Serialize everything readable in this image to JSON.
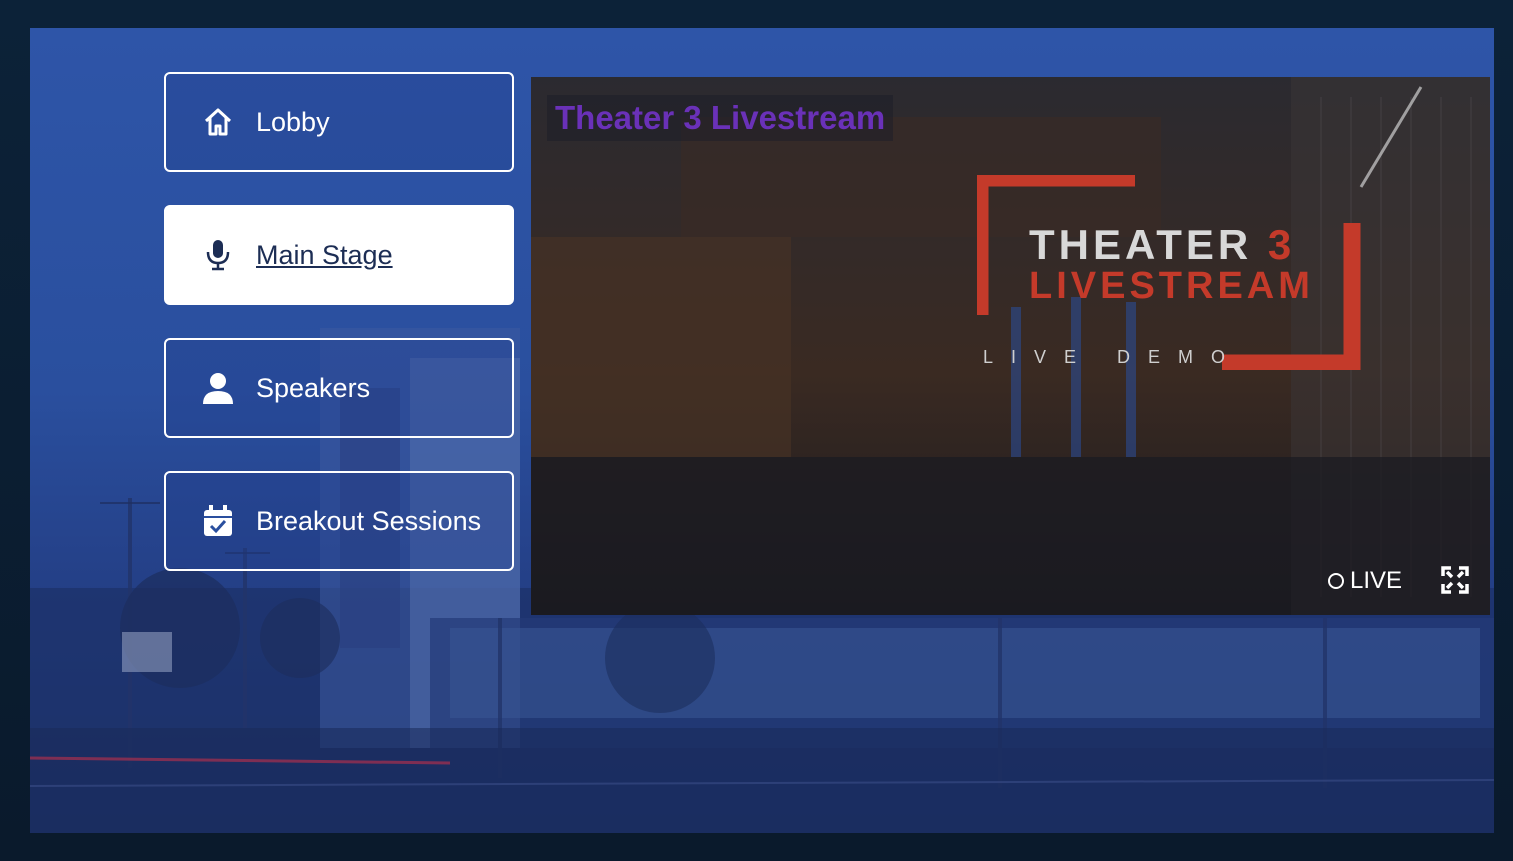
{
  "nav": {
    "items": [
      {
        "label": "Lobby",
        "icon": "home-icon",
        "active": false
      },
      {
        "label": "Main Stage",
        "icon": "microphone-icon",
        "active": true
      },
      {
        "label": "Speakers",
        "icon": "user-icon",
        "active": false
      },
      {
        "label": "Breakout Sessions",
        "icon": "calendar-check-icon",
        "active": false
      }
    ]
  },
  "video": {
    "title": "Theater 3 Livestream",
    "logo_line1": "THEATER",
    "logo_number": "3",
    "logo_line2": "LIVESTREAM",
    "logo_sub": "LIVE DEMO",
    "live_label": "LIVE",
    "fullscreen_icon": "expand-icon"
  },
  "colors": {
    "accent_purple": "#6a31b8",
    "logo_red": "#c43a2a",
    "page_blue": "#2a4f9e"
  }
}
